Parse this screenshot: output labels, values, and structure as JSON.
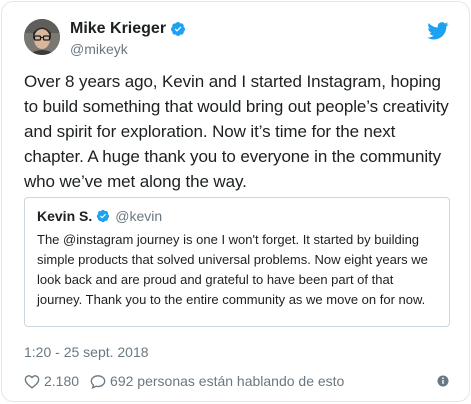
{
  "tweet": {
    "author_name": "Mike Krieger",
    "author_handle": "@mikeyk",
    "text": "Over 8 years ago, Kevin and I started Instagram, hoping to build something that would bring out people’s creativity and spirit for exploration. Now it’s time for the next chapter. A huge thank you to everyone in the community who we’ve met along the way.",
    "timestamp": "1:20 - 25 sept. 2018",
    "likes": "2.180",
    "conversation": "692 personas están hablando de esto"
  },
  "quote": {
    "author_name": "Kevin S.",
    "author_handle": "@kevin",
    "text": "The @instagram journey is one I won't forget. It started by building simple products that solved universal problems. Now eight years we look back and are proud and grateful to have been part of that journey. Thank you to the entire community as we move on for now."
  },
  "icons": {
    "verified": "verified-badge-icon",
    "brand": "twitter-bird-icon",
    "like": "heart-icon",
    "reply": "speech-bubble-icon",
    "info": "info-icon"
  },
  "colors": {
    "brand_blue": "#1da1f2",
    "text": "#1c2022",
    "muted": "#697882",
    "border": "#e1e8ed"
  }
}
